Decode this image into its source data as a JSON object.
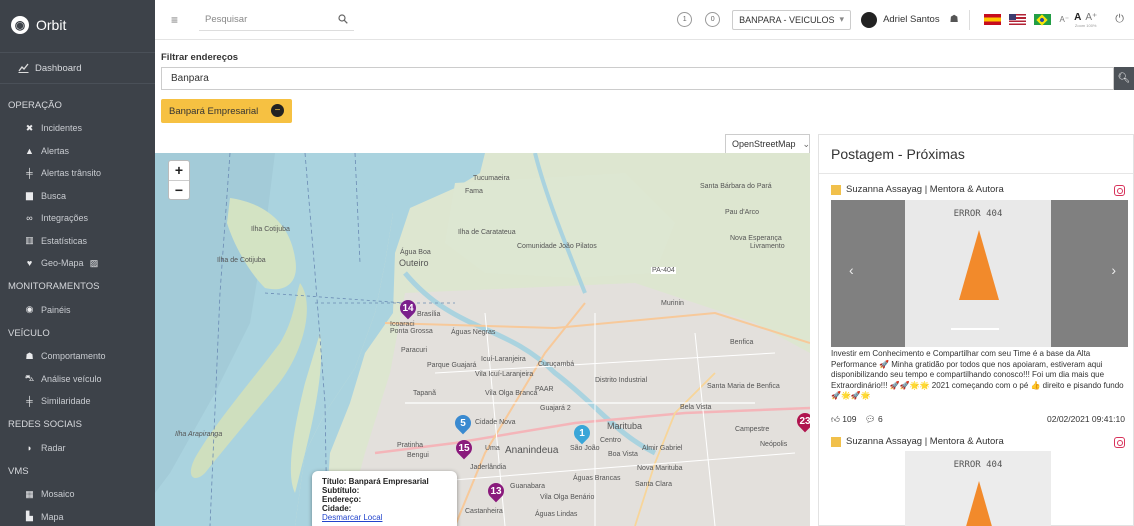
{
  "app": {
    "name": "Orbit"
  },
  "sidebar": {
    "dashboard": "Dashboard",
    "sections": [
      {
        "title": "OPERAÇÃO",
        "items": [
          "Incidentes",
          "Alertas",
          "Alertas trânsito",
          "Busca",
          "Integrações",
          "Estatísticas",
          "Geo-Mapa"
        ]
      },
      {
        "title": "MONITORAMENTOS",
        "items": [
          "Painéis"
        ]
      },
      {
        "title": "VEÍCULO",
        "items": [
          "Comportamento",
          "Análise veículo",
          "Similaridade"
        ]
      },
      {
        "title": "REDES SOCIAIS",
        "items": [
          "Radar"
        ]
      },
      {
        "title": "VMS",
        "items": [
          "Mosaico",
          "Mapa"
        ]
      }
    ]
  },
  "topbar": {
    "search_placeholder": "Pesquisar",
    "badge1": "1",
    "badge2": "0",
    "org": "BANPARA - VEICULOS",
    "user": "Adriel Santos",
    "font_small": "A⁻",
    "font_normal": "A",
    "font_large": "A⁺",
    "zoom": "Zoom 100%"
  },
  "filter": {
    "label": "Filtrar endereços",
    "value": "Banpara",
    "chip": "Banpará Empresarial"
  },
  "map": {
    "layer": "OpenStreetMap",
    "zoom_in": "+",
    "zoom_out": "−",
    "labels": [
      "Ilha Cotijuba",
      "Ilha de Cotijuba",
      "Tucumaeira",
      "Fama",
      "Ilha de Caratateua",
      "Água Boa",
      "Outeiro",
      "Comunidade João Pilatos",
      "Santa Bárbara do Pará",
      "Pau d'Arco",
      "Nova Esperança",
      "Livramento",
      "Brasília",
      "Icoaraci",
      "Ponta Grossa",
      "Águas Negras",
      "Murinin",
      "Paracuri",
      "Parque Guajará",
      "Icuí-Laranjeira",
      "Curuçambá",
      "Tapanã",
      "Vila Icuí-Laranjeira",
      "Distrito Industrial",
      "Santa Maria de Benfica",
      "Benfica",
      "Guajará 2",
      "Vila Olga Branca",
      "PAAR",
      "Bela Vista",
      "Cidade Nova",
      "Marituba",
      "Ilha Arapiranga",
      "Pratinha",
      "Bengui",
      "Ananindeua",
      "Uma",
      "São João",
      "Centro",
      "Almir Gabriel",
      "Boa Vista",
      "Campestre",
      "Jaderlândia",
      "Águas Brancas",
      "Santa Clara",
      "Nova Marituba",
      "Guanabara",
      "Castanheira",
      "Águas Lindas",
      "Vila Olga Benário",
      "PA-404",
      "Neópolis"
    ],
    "markers": [
      {
        "n": "14",
        "color": "#7b1f8c"
      },
      {
        "n": "5",
        "color": "#3a8ad0"
      },
      {
        "n": "15",
        "color": "#8a1a7c"
      },
      {
        "n": "1",
        "color": "#3aa6d8"
      },
      {
        "n": "13",
        "color": "#8a1a7c"
      },
      {
        "n": "23",
        "color": "#b0144e"
      }
    ],
    "popup": {
      "titulo_label": "Título:",
      "titulo": "Banpará Empresarial",
      "subtitulo_label": "Subtítulo:",
      "endereco_label": "Endereço:",
      "cidade_label": "Cidade:",
      "action": "Desmarcar Local"
    }
  },
  "panel": {
    "title": "Postagem - Próximas",
    "posts": [
      {
        "author": "Suzanna Assayag | Mentora & Autora",
        "image_text": "ERROR 404",
        "text": "Investir em Conhecimento e Compartilhar com seu Time é a base da Alta Performance 🚀 Minha gratidão por todos que nos apoiaram, estiveram aqui disponibilizando seu tempo e compartilhando conosco!!! Foi um dia mais que Extraordinário!!! 🚀🚀🌟🌟 2021 começando com o pé 👍 direito e pisando fundo 🚀🌟🚀🌟",
        "likes": "109",
        "comments": "6",
        "date": "02/02/2021 09:41:10"
      },
      {
        "author": "Suzanna Assayag | Mentora & Autora",
        "image_text": "ERROR 404"
      }
    ]
  },
  "colors": {
    "sidebar": "#3d4249",
    "chip": "#f6c142",
    "accent": "#b0144e"
  }
}
